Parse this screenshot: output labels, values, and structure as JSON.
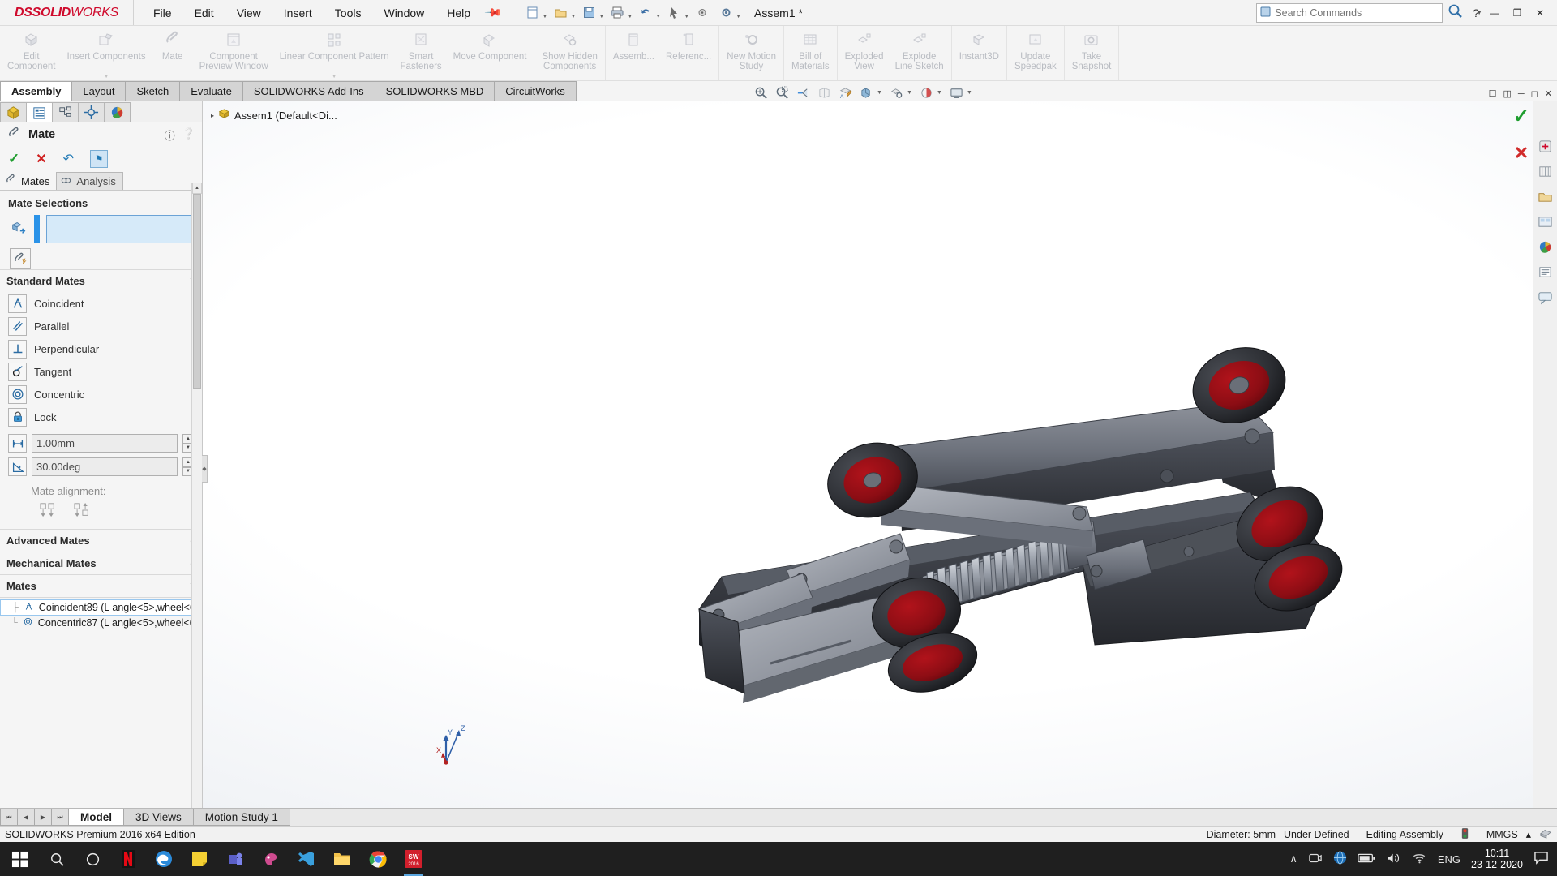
{
  "titlebar": {
    "logo_ds": "DS",
    "logo_solid": "SOLID",
    "logo_works": "WORKS",
    "menus": [
      "File",
      "Edit",
      "View",
      "Insert",
      "Tools",
      "Window",
      "Help"
    ],
    "pin_icon": "pushpin-icon",
    "document_title": "Assem1 *",
    "search_placeholder": "Search Commands",
    "search_value": "",
    "help_label": "?",
    "min_label": "—",
    "max_label": "❐",
    "close_label": "✕"
  },
  "ribbon": {
    "groups": [
      {
        "items": [
          {
            "label": "Edit\nComponent",
            "icon": "edit-component-icon",
            "dropdown": false
          },
          {
            "label": "Insert Components",
            "icon": "insert-components-icon",
            "dropdown": true
          },
          {
            "label": "Mate",
            "icon": "mate-icon",
            "dropdown": false
          },
          {
            "label": "Component\nPreview Window",
            "icon": "component-preview-window-icon",
            "dropdown": false
          },
          {
            "label": "Linear Component Pattern",
            "icon": "linear-component-pattern-icon",
            "dropdown": true
          },
          {
            "label": "Smart\nFasteners",
            "icon": "smart-fasteners-icon",
            "dropdown": false
          },
          {
            "label": "Move Component",
            "icon": "move-component-icon",
            "dropdown": false
          }
        ]
      },
      {
        "items": [
          {
            "label": "Show Hidden\nComponents",
            "icon": "show-hidden-components-icon",
            "dropdown": false
          }
        ]
      },
      {
        "items": [
          {
            "label": "Assemb...",
            "icon": "assembly-features-icon",
            "dropdown": false
          },
          {
            "label": "Referenc...",
            "icon": "reference-geometry-icon",
            "dropdown": false
          }
        ]
      },
      {
        "items": [
          {
            "label": "New Motion\nStudy",
            "icon": "new-motion-study-icon",
            "dropdown": false
          }
        ]
      },
      {
        "items": [
          {
            "label": "Bill of\nMaterials",
            "icon": "bill-of-materials-icon",
            "dropdown": false
          }
        ]
      },
      {
        "items": [
          {
            "label": "Exploded\nView",
            "icon": "exploded-view-icon",
            "dropdown": false
          },
          {
            "label": "Explode\nLine Sketch",
            "icon": "explode-line-sketch-icon",
            "dropdown": false
          }
        ]
      },
      {
        "items": [
          {
            "label": "Instant3D",
            "icon": "instant3d-icon",
            "dropdown": false
          }
        ]
      },
      {
        "items": [
          {
            "label": "Update\nSpeedpak",
            "icon": "update-speedpak-icon",
            "dropdown": false
          }
        ]
      },
      {
        "items": [
          {
            "label": "Take\nSnapshot",
            "icon": "take-snapshot-icon",
            "dropdown": false
          }
        ]
      }
    ]
  },
  "tabs": {
    "items": [
      {
        "label": "Assembly",
        "active": true
      },
      {
        "label": "Layout",
        "active": false
      },
      {
        "label": "Sketch",
        "active": false
      },
      {
        "label": "Evaluate",
        "active": false
      },
      {
        "label": "SOLIDWORKS Add-Ins",
        "active": false
      },
      {
        "label": "SOLIDWORKS MBD",
        "active": false
      },
      {
        "label": "CircuitWorks",
        "active": false
      }
    ],
    "view_tools": [
      "zoom-to-fit-icon",
      "zoom-to-area-icon",
      "previous-view-icon",
      "section-view-icon",
      "view-orientation-icon",
      "display-style-icon",
      "hide-show-items-icon",
      "edit-appearance-icon",
      "apply-scene-icon",
      "view-settings-icon"
    ],
    "window_buttons": [
      "restore-down-icon",
      "split-view-icon",
      "minimize-icon",
      "maximize-icon",
      "close-icon"
    ]
  },
  "property_manager": {
    "pm_tabs": [
      {
        "name": "feature-manager-design-tree-tab",
        "active": false
      },
      {
        "name": "property-manager-tab",
        "active": true
      },
      {
        "name": "configuration-manager-tab",
        "active": false
      },
      {
        "name": "dimxpert-manager-tab",
        "active": false
      },
      {
        "name": "display-manager-tab",
        "active": false
      }
    ],
    "title": "Mate",
    "header_icon": "mate-paperclip-icon",
    "actions": {
      "ok": "✓",
      "cancel": "✕",
      "undo": "↶",
      "pin": "⚑"
    },
    "sub_tabs": [
      {
        "label": "Mates",
        "active": true,
        "icon": "paperclip-icon"
      },
      {
        "label": "Analysis",
        "active": false,
        "icon": "analysis-icon"
      }
    ],
    "mate_selections": {
      "title": "Mate Selections",
      "selection_value": "",
      "field_icon": "entities-to-mate-icon",
      "multi_mate_button": "multiple-mate-mode-icon"
    },
    "standard_mates": {
      "title": "Standard Mates",
      "chevron": "⌃",
      "items": [
        {
          "label": "Coincident",
          "icon": "coincident-icon"
        },
        {
          "label": "Parallel",
          "icon": "parallel-icon"
        },
        {
          "label": "Perpendicular",
          "icon": "perpendicular-icon"
        },
        {
          "label": "Tangent",
          "icon": "tangent-icon"
        },
        {
          "label": "Concentric",
          "icon": "concentric-icon"
        },
        {
          "label": "Lock",
          "icon": "lock-icon"
        }
      ],
      "distance_value": "1.00mm",
      "distance_icon": "distance-mate-icon",
      "angle_value": "30.00deg",
      "angle_icon": "angle-mate-icon",
      "mate_alignment_label": "Mate alignment:",
      "alignment_buttons": [
        "aligned-icon",
        "anti-aligned-icon"
      ]
    },
    "advanced_mates": {
      "title": "Advanced Mates",
      "chevron": "⌄"
    },
    "mechanical_mates": {
      "title": "Mechanical Mates",
      "chevron": "⌄"
    },
    "mates": {
      "title": "Mates",
      "chevron": "⌃",
      "rows": [
        "Coincident89 (L angle<5>,wheel<6",
        "Concentric87 (L angle<5>,wheel<6"
      ]
    }
  },
  "viewport": {
    "feature_tree_root": "Assem1  (Default<Di...",
    "tree_arrow": "▸",
    "confirm_ok": "✓",
    "confirm_cancel": "✕",
    "triad_labels": {
      "z": "Z",
      "y": "Y",
      "x": "X"
    },
    "right_toolbar": [
      "view-orientation-icon",
      "display-style-icon",
      "hide-show-icon",
      "edit-appearance-icon",
      "apply-scene-icon",
      "view-settings-icon",
      "section-view-icon",
      "zoom-icon"
    ]
  },
  "bottom_tabs": {
    "nav": [
      "⏮",
      "◀",
      "▶",
      "⏭"
    ],
    "items": [
      {
        "label": "Model",
        "active": true
      },
      {
        "label": "3D Views",
        "active": false
      },
      {
        "label": "Motion Study 1",
        "active": false
      }
    ]
  },
  "statusbar": {
    "edition": "SOLIDWORKS Premium 2016 x64 Edition",
    "diameter": "Diameter: 5mm",
    "state": "Under Defined",
    "mode": "Editing Assembly",
    "indicator_icon": "traffic-light-icon",
    "units": "MMGS",
    "units_caret": "▴",
    "overlay_icon": "overlay-icon"
  },
  "taskbar": {
    "start_icon": "windows-start-icon",
    "search_icon": "search-icon",
    "cortana_icon": "cortana-circle-icon",
    "apps": [
      {
        "name": "netflix-icon",
        "active": false
      },
      {
        "name": "microsoft-edge-icon",
        "active": false
      },
      {
        "name": "sticky-notes-icon",
        "active": false
      },
      {
        "name": "teams-icon",
        "active": false
      },
      {
        "name": "paint-3d-icon",
        "active": false
      },
      {
        "name": "visual-studio-code-icon",
        "active": false
      },
      {
        "name": "file-explorer-icon",
        "active": false
      },
      {
        "name": "google-chrome-icon",
        "active": false
      },
      {
        "name": "solidworks-icon",
        "active": true
      }
    ],
    "tray": {
      "chevron": "∧",
      "icons": [
        "screen-recorder-icon",
        "blue-globe-icon",
        "battery-icon",
        "volume-icon",
        "wifi-icon"
      ],
      "language": "ENG",
      "time": "10:11",
      "date": "23-12-2020",
      "action_center": "notification-icon"
    }
  }
}
